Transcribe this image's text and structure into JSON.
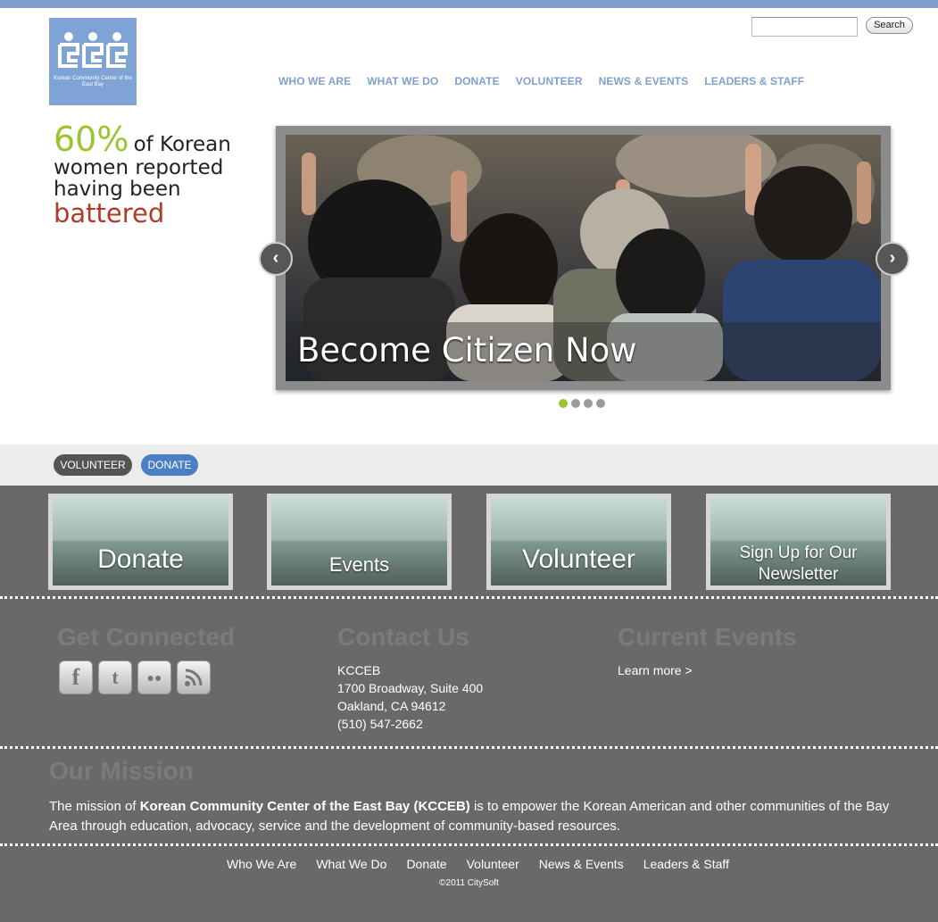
{
  "header": {
    "logo_text": "Korean Community Center of the East Bay",
    "search_placeholder": "",
    "search_button": "Search",
    "nav": [
      "WHO WE ARE",
      "WHAT WE DO",
      "DONATE",
      "VOLUNTEER",
      "NEWS & EVENTS",
      "LEADERS & STAFF"
    ]
  },
  "stat": {
    "percent": "60%",
    "line1": "of Korean",
    "line2": "women reported",
    "line3": "having been",
    "highlight": "battered"
  },
  "slider": {
    "caption": "Become Citizen Now",
    "prev_icon": "chevron-left-icon",
    "next_icon": "chevron-right-icon",
    "dots": 4,
    "active_dot": 1
  },
  "actions": {
    "volunteer": "VOLUNTEER",
    "donate": "DONATE"
  },
  "tiles": [
    {
      "label": "Donate"
    },
    {
      "label": "Events"
    },
    {
      "label": "Volunteer"
    },
    {
      "label": "Sign Up for Our Newsletter"
    }
  ],
  "connected": {
    "title": "Get Connected",
    "icons": [
      "facebook-icon",
      "twitter-icon",
      "flickr-icon",
      "rss-icon"
    ]
  },
  "contact": {
    "title": "Contact Us",
    "lines": [
      "KCCEB",
      "1700 Broadway, Suite 400",
      "Oakland, CA 94612",
      "(510) 547-2662"
    ]
  },
  "events": {
    "title": "Current Events",
    "link": "Learn more >"
  },
  "mission": {
    "title": "Our Mission",
    "prefix": "The mission of ",
    "org": "Korean Community Center of the East Bay (KCCEB)",
    "suffix": " is to empower the Korean American and other communities of the Bay Area through education, advocacy, service and the development of community-based resources."
  },
  "footer": {
    "nav": [
      "Who We Are",
      "What We Do",
      "Donate",
      "Volunteer",
      "News & Events",
      "Leaders & Staff"
    ],
    "copyright": "©2011 CitySoft"
  },
  "colors": {
    "brand_blue": "#7f9fcf",
    "accent_green": "#9cc431",
    "accent_red": "#b13a24",
    "footer_gray": "#696969"
  }
}
